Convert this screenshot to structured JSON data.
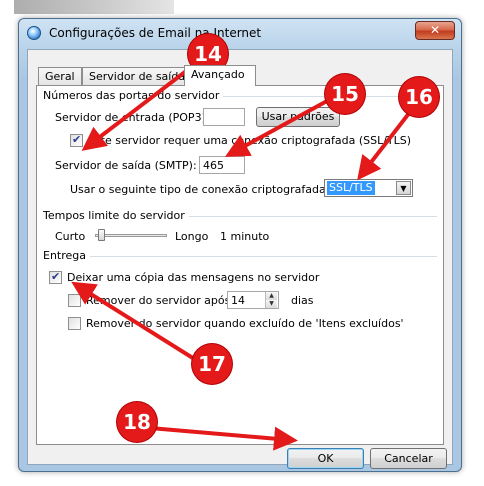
{
  "window": {
    "title": "Configurações de Email na Internet",
    "close_glyph": "✕"
  },
  "tabs": [
    {
      "label": "Geral",
      "active": false
    },
    {
      "label": "Servidor de saída",
      "active": false
    },
    {
      "label": "Avançado",
      "active": true
    }
  ],
  "ports_group": {
    "title": "Números das portas do servidor",
    "incoming_label": "Servidor de entrada (POP3):",
    "incoming_value": "",
    "use_defaults_label": "Usar padrões",
    "ssl_check_label": "Este servidor requer uma conexão criptografada (SSL/TLS)",
    "ssl_checked": true,
    "outgoing_label": "Servidor de saída (SMTP):",
    "outgoing_value": "465",
    "encryption_label": "Usar o seguinte tipo de conexão criptografada:",
    "encryption_value": "SSL/TLS"
  },
  "timeouts_group": {
    "title": "Tempos limite do servidor",
    "short_label": "Curto",
    "long_label": "Longo",
    "value_label": "1 minuto",
    "slider_level": 0.05
  },
  "delivery_group": {
    "title": "Entrega",
    "leave_copy_label": "Deixar uma cópia das mensagens no servidor",
    "leave_copy_checked": true,
    "remove_after_label": "Remover do servidor após",
    "remove_after_checked": false,
    "days_value": "14",
    "days_label": "dias",
    "remove_deleted_label": "Remover do servidor quando excluído de 'Itens excluídos'",
    "remove_deleted_checked": false
  },
  "buttons": {
    "ok": "OK",
    "cancel": "Cancelar"
  },
  "callouts": [
    "14",
    "15",
    "16",
    "17",
    "18"
  ],
  "colors": {
    "callout_red": "#e41a1a",
    "selection_blue": "#3399ff"
  }
}
